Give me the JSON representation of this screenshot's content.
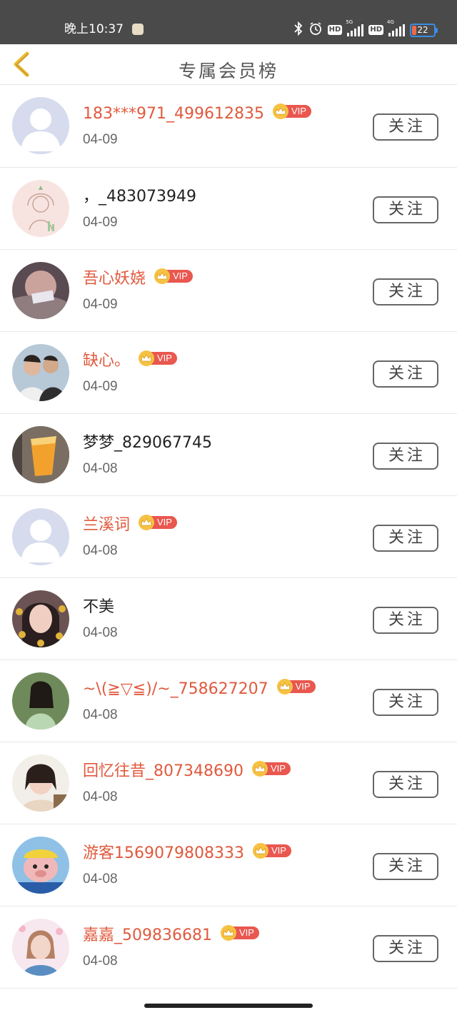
{
  "status_bar": {
    "time": "晚上10:37",
    "hd_label": "HD",
    "net_5g": "5G",
    "net_4g": "4G",
    "battery": "22"
  },
  "header": {
    "title": "专属会员榜",
    "back_icon": "chevron-left-icon"
  },
  "vip_label": "VIP",
  "follow_label": "关注",
  "members": [
    {
      "name": "183***971_499612835",
      "date": "04-09",
      "vip": true,
      "avatar": "default"
    },
    {
      "name": "，_483073949",
      "date": "04-09",
      "vip": false,
      "avatar": "sketch"
    },
    {
      "name": "吾心妖娆",
      "date": "04-09",
      "vip": true,
      "avatar": "photo-pink"
    },
    {
      "name": "缺心。",
      "date": "04-09",
      "vip": true,
      "avatar": "photo-couple"
    },
    {
      "name": "梦梦_829067745",
      "date": "04-08",
      "vip": false,
      "avatar": "photo-juice"
    },
    {
      "name": "兰溪词",
      "date": "04-08",
      "vip": true,
      "avatar": "default"
    },
    {
      "name": "不美",
      "date": "04-08",
      "vip": false,
      "avatar": "photo-girl"
    },
    {
      "name": "~\\(≧▽≦)/~_758627207",
      "date": "04-08",
      "vip": true,
      "avatar": "photo-green"
    },
    {
      "name": "回忆往昔_807348690",
      "date": "04-08",
      "vip": true,
      "avatar": "photo-woman"
    },
    {
      "name": "游客1569079808333",
      "date": "04-08",
      "vip": true,
      "avatar": "cartoon"
    },
    {
      "name": "嘉嘉_509836681",
      "date": "04-08",
      "vip": true,
      "avatar": "photo-flower"
    }
  ],
  "colors": {
    "vip_name": "#e05a3e",
    "plain_name": "#222222",
    "vip_badge": "#e9574f",
    "crown": "#f6c243",
    "status_bar": "#4a4a4a",
    "back_arrow": "#f0b92a"
  }
}
